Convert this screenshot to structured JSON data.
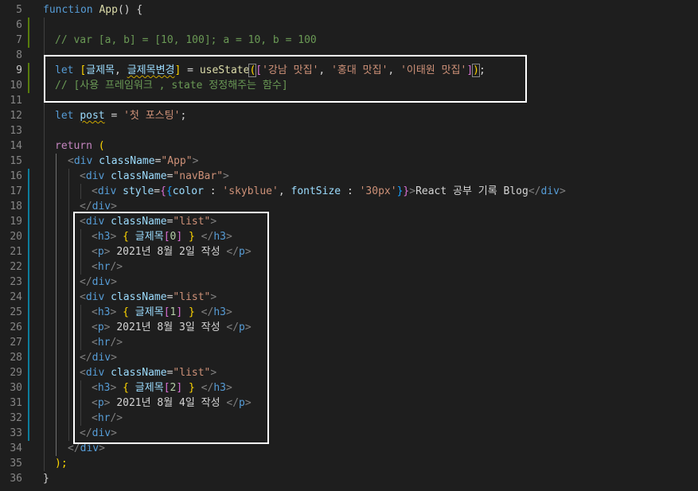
{
  "colors": {
    "background": "#1e1e1e",
    "keyword": "#569cd6",
    "function": "#dcdcaa",
    "variable": "#9cdcfe",
    "string": "#ce9178",
    "comment": "#6a9955",
    "line_number": "#858585",
    "highlight_box": "#ffffff"
  },
  "line_numbers": [
    "5",
    "6",
    "7",
    "8",
    "9",
    "10",
    "11",
    "12",
    "13",
    "14",
    "15",
    "16",
    "17",
    "18",
    "19",
    "20",
    "21",
    "22",
    "23",
    "24",
    "25",
    "26",
    "27",
    "28",
    "29",
    "30",
    "31",
    "32",
    "33",
    "34",
    "35",
    "36"
  ],
  "code": {
    "l5": {
      "kw": "function",
      "fn": "App",
      "rest": "() {"
    },
    "l7": {
      "comment": "// var [a, b] = [10, 100]; a = 10, b = 100"
    },
    "l9": {
      "kw": "let",
      "open": "[",
      "v1": "글제목",
      "comma": ",",
      "v2": "글제목변경",
      "close": "]",
      "eq": "=",
      "fn": "useState",
      "s1": "'강남 맛집'",
      "s2": "'홍대 맛집'",
      "s3": "'이태원 맛집'",
      "end": ");"
    },
    "l10": {
      "comment": "// [사용 프레임워크 , state 정정해주는 함수]"
    },
    "l12": {
      "kw": "let",
      "v": "post",
      "eq": "=",
      "str": "'첫 포스팅'",
      "end": ";"
    },
    "l14": {
      "kw": "return",
      "rest": "("
    },
    "l15": {
      "tag": "div",
      "attr": "className",
      "val": "\"App\""
    },
    "l16": {
      "tag": "div",
      "attr": "className",
      "val": "\"navBar\""
    },
    "l17": {
      "tag": "div",
      "attr": "style",
      "k1": "color",
      "v1": "'skyblue'",
      "k2": "fontSize",
      "v2": "'30px'",
      "text": "React 공부 기록 Blog"
    },
    "l18": {
      "tag": "div"
    },
    "l19": {
      "tag": "div",
      "attr": "className",
      "val": "\"list\""
    },
    "l20": {
      "tag": "h3",
      "var": "글제목",
      "idx": "0"
    },
    "l21": {
      "tag": "p",
      "text": "2021년 8월 2일 작성"
    },
    "l22": {
      "tag": "hr"
    },
    "l23": {
      "tag": "div"
    },
    "l24": {
      "tag": "div",
      "attr": "className",
      "val": "\"list\""
    },
    "l25": {
      "tag": "h3",
      "var": "글제목",
      "idx": "1"
    },
    "l26": {
      "tag": "p",
      "text": "2021년 8월 3일 작성"
    },
    "l27": {
      "tag": "hr"
    },
    "l28": {
      "tag": "div"
    },
    "l29": {
      "tag": "div",
      "attr": "className",
      "val": "\"list\""
    },
    "l30": {
      "tag": "h3",
      "var": "글제목",
      "idx": "2"
    },
    "l31": {
      "tag": "p",
      "text": "2021년 8월 4일 작성"
    },
    "l32": {
      "tag": "hr"
    },
    "l33": {
      "tag": "div"
    },
    "l34": {
      "tag": "div"
    },
    "l35": {
      "rest": ");"
    },
    "l36": {
      "rest": "}"
    }
  }
}
